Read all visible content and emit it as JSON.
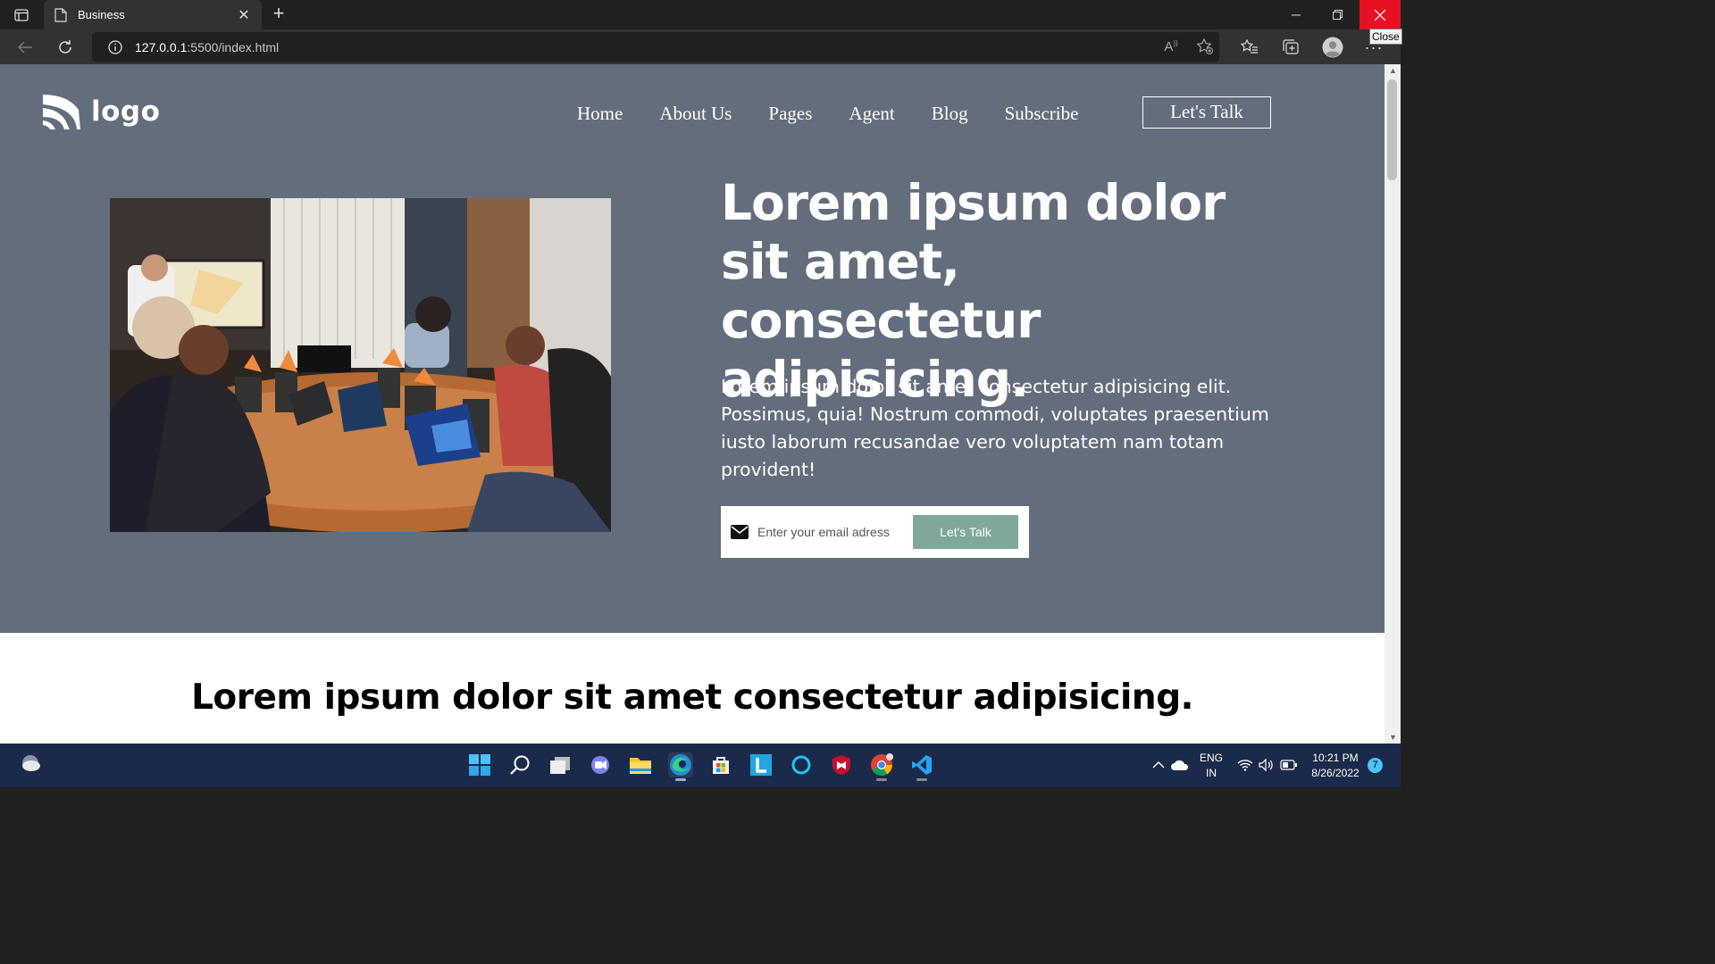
{
  "browser": {
    "tab_title": "Business",
    "url_host": "127.0.0.1",
    "url_rest": ":5500/index.html",
    "close_tooltip": "Close"
  },
  "page": {
    "logo_text": "logo",
    "nav": [
      "Home",
      "About Us",
      "Pages",
      "Agent",
      "Blog",
      "Subscribe"
    ],
    "header_cta": "Let's Talk",
    "hero": {
      "headline": "Lorem ipsum dolor sit amet, consectetur adipisicing.",
      "description": "Lorem ipsum dolor sit amet consectetur adipisicing elit. Possimus, quia! Nostrum commodi, voluptates praesentium iusto laborum recusandae vero voluptatem nam totam provident!",
      "email_placeholder": "Enter your email adress",
      "submit_label": "Let's Talk"
    },
    "section2_heading": "Lorem ipsum dolor sit amet consectetur adipisicing."
  },
  "taskbar": {
    "lang_line1": "ENG",
    "lang_line2": "IN",
    "time": "10:21 PM",
    "date": "8/26/2022",
    "notification_count": "7",
    "apps": [
      "windows-start",
      "search",
      "task-view",
      "teams-chat",
      "file-explorer",
      "edge",
      "microsoft-store",
      "l-app",
      "cortana",
      "mcafee",
      "chrome",
      "vscode"
    ]
  },
  "colors": {
    "hero_bg": "#636d7c",
    "cta_green": "#7fa898",
    "close_red": "#e81123",
    "taskbar_bg": "#1b2a4a"
  }
}
